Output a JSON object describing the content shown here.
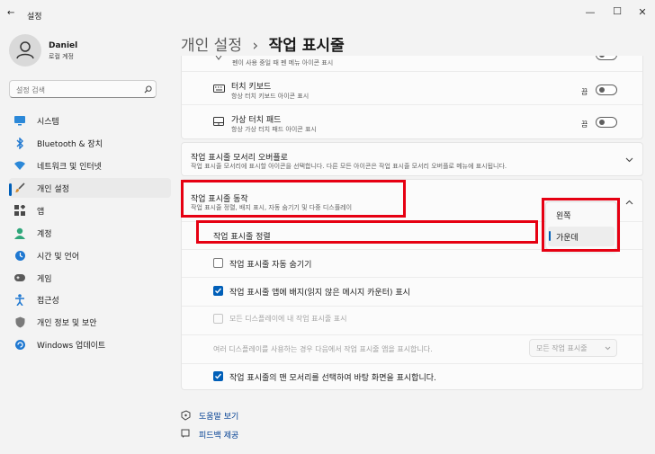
{
  "window": {
    "title": "설정",
    "back": "←",
    "min": "—",
    "max": "☐",
    "close": "✕"
  },
  "user": {
    "name": "Daniel",
    "account": "로컬 계정"
  },
  "search": {
    "placeholder": "설정 검색"
  },
  "nav": [
    {
      "label": "시스템",
      "icon": "monitor-icon",
      "color": "#2b88d8"
    },
    {
      "label": "Bluetooth & 장치",
      "icon": "bluetooth-icon",
      "color": "#1f78d1"
    },
    {
      "label": "네트워크 및 인터넷",
      "icon": "wifi-icon",
      "color": "#2b88d8"
    },
    {
      "label": "개인 설정",
      "icon": "brush-icon",
      "color": "#d38a2c"
    },
    {
      "label": "앱",
      "icon": "apps-icon",
      "color": "#4a4a4a"
    },
    {
      "label": "계정",
      "icon": "person-icon",
      "color": "#2fa67a"
    },
    {
      "label": "시간 및 언어",
      "icon": "globe-clock-icon",
      "color": "#1f78d1"
    },
    {
      "label": "게임",
      "icon": "gamepad-icon",
      "color": "#5a5a5a"
    },
    {
      "label": "접근성",
      "icon": "accessibility-icon",
      "color": "#1f78d1"
    },
    {
      "label": "개인 정보 및 보안",
      "icon": "shield-icon",
      "color": "#7a7a7a"
    },
    {
      "label": "Windows 업데이트",
      "icon": "update-icon",
      "color": "#1f78d1"
    }
  ],
  "breadcrumb": {
    "parent": "개인 설정",
    "sep": "›",
    "current": "작업 표시줄"
  },
  "rows": {
    "pen_cut": "펜이 사용 중일 때 펜 메뉴 아이콘 표시",
    "touch_kb": {
      "title": "터치 키보드",
      "desc": "항상 터치 키보드 아이콘 표시",
      "state": "끔"
    },
    "touchpad": {
      "title": "가상 터치 패드",
      "desc": "항상 가상 터치 패드 아이콘 표시",
      "state": "끔"
    },
    "overflow": {
      "title": "작업 표시줄 모서리 오버플로",
      "desc": "작업 표시줄 모서리에 표시할 아이콘을 선택합니다. 다른 모든 아이콘은 작업 표시줄 모서리 오버플로 메뉴에 표시됩니다."
    },
    "behaviors": {
      "title": "작업 표시줄 동작",
      "desc": "작업 표시줄 정렬, 배지 표시, 자동 숨기기 및 다중 디스플레이"
    },
    "alignment": {
      "title": "작업 표시줄 정렬",
      "options": [
        "왼쪽",
        "가운데"
      ],
      "selected": "가운데"
    },
    "autohide": "작업 표시줄 자동 숨기기",
    "badges": "작업 표시줄 앱에 배지(읽지 않은 메시지 카운터) 표시",
    "all_displays": "모든 디스플레이에 내 작업 표시줄 표시",
    "multi_display": {
      "label": "여러 디스플레이를 사용하는 경우 다음에서 작업 표시줄 앱을 표시합니다.",
      "value": "모든 작업 표시줄"
    },
    "corner_click": "작업 표시줄의 맨 모서리를 선택하여 바탕 화면을 표시합니다."
  },
  "footer": {
    "help": "도움말 보기",
    "feedback": "피드백 제공"
  },
  "colors": {
    "accent": "#005fb8",
    "highlight": "#e60012"
  }
}
